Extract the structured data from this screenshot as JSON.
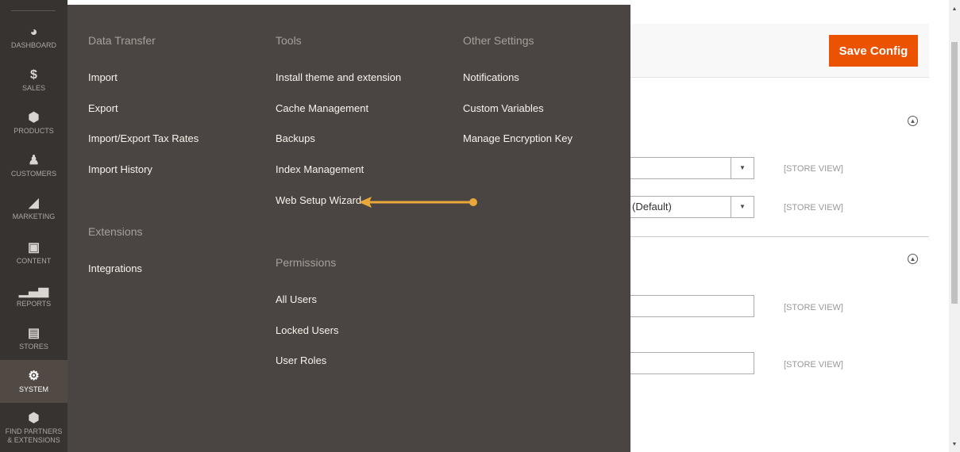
{
  "nav": {
    "items": [
      {
        "label": "DASHBOARD",
        "icon": "dashboard-icon"
      },
      {
        "label": "SALES",
        "icon": "dollar-icon"
      },
      {
        "label": "PRODUCTS",
        "icon": "box-icon"
      },
      {
        "label": "CUSTOMERS",
        "icon": "person-icon"
      },
      {
        "label": "MARKETING",
        "icon": "megaphone-icon"
      },
      {
        "label": "CONTENT",
        "icon": "layout-icon"
      },
      {
        "label": "REPORTS",
        "icon": "bar-chart-icon"
      },
      {
        "label": "STORES",
        "icon": "storefront-icon"
      },
      {
        "label": "SYSTEM",
        "icon": "gear-icon",
        "active": true
      },
      {
        "label": "FIND PARTNERS & EXTENSIONS",
        "icon": "cubes-icon"
      }
    ]
  },
  "flyout": {
    "data_transfer": {
      "title": "Data Transfer",
      "items": [
        "Import",
        "Export",
        "Import/Export Tax Rates",
        "Import History"
      ]
    },
    "extensions": {
      "title": "Extensions",
      "items": [
        "Integrations"
      ]
    },
    "tools": {
      "title": "Tools",
      "items": [
        "Install theme and extension",
        "Cache Management",
        "Backups",
        "Index Management",
        "Web Setup Wizard"
      ]
    },
    "permissions": {
      "title": "Permissions",
      "items": [
        "All Users",
        "Locked Users",
        "User Roles"
      ]
    },
    "other_settings": {
      "title": "Other Settings",
      "items": [
        "Notifications",
        "Custom Variables",
        "Manage Encryption Key"
      ]
    }
  },
  "page": {
    "save_label": "Save Config",
    "select_2_value": "(Default)",
    "scope_label": "[STORE VIEW]"
  },
  "colors": {
    "accent": "#eb5202",
    "arrow": "#eba83a",
    "nav_bg": "#373330",
    "flyout_bg": "#4a4542"
  }
}
